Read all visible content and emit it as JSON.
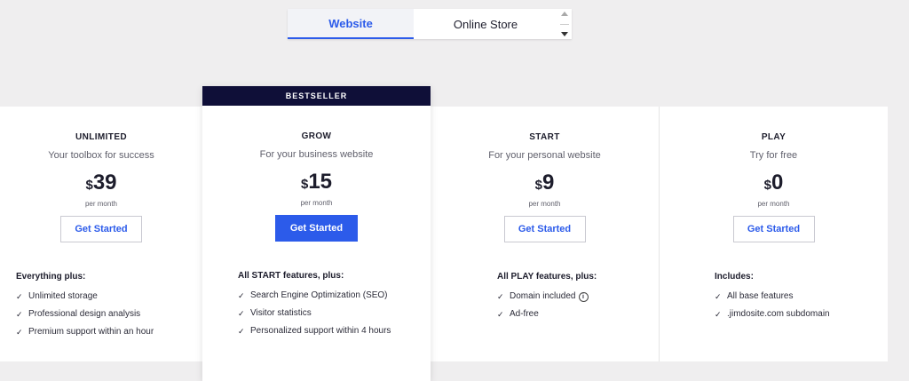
{
  "tabs": [
    {
      "label": "Website",
      "active": true
    },
    {
      "label": "Online Store",
      "active": false
    }
  ],
  "colors": {
    "accent": "#2c5bea",
    "ribbon": "#0f0f38",
    "background": "#efeeef"
  },
  "plans": [
    {
      "name": "UNLIMITED",
      "tagline": "Your toolbox for success",
      "currency": "$",
      "price": "39",
      "period": "per month",
      "button": "Get Started",
      "features_head": "Everything plus:",
      "features": [
        "Unlimited storage",
        "Professional design analysis",
        "Premium support within an hour"
      ]
    },
    {
      "ribbon": "BESTSELLER",
      "name": "GROW",
      "tagline": "For your business website",
      "currency": "$",
      "price": "15",
      "period": "per month",
      "button": "Get Started",
      "features_head": "All START features, plus:",
      "features": [
        "Search Engine Optimization (SEO)",
        "Visitor statistics",
        "Personalized support within 4 hours"
      ]
    },
    {
      "name": "START",
      "tagline": "For your personal website",
      "currency": "$",
      "price": "9",
      "period": "per month",
      "button": "Get Started",
      "features_head": "All PLAY features, plus:",
      "features": [
        "Domain included",
        "Ad-free"
      ]
    },
    {
      "name": "PLAY",
      "tagline": "Try for free",
      "currency": "$",
      "price": "0",
      "period": "per month",
      "button": "Get Started",
      "features_head": "Includes:",
      "features": [
        "All base features",
        ".jimdosite.com subdomain"
      ]
    }
  ],
  "icons": {
    "check": "check-icon",
    "info": "info-icon"
  }
}
